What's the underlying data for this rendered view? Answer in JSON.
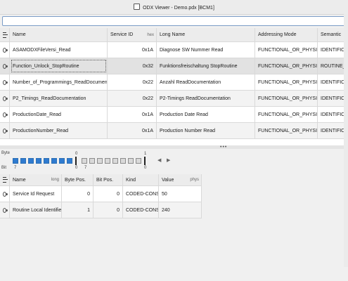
{
  "window": {
    "title": "ODX Viewer - Demo.pdx [BCM1]"
  },
  "search": {
    "value": ""
  },
  "main_table": {
    "headers": {
      "name": "Name",
      "service_id": "Service ID",
      "service_id_tag": "hex",
      "long_name": "Long Name",
      "addressing": "Addressing Mode",
      "semantic": "Semantic"
    },
    "rows": [
      {
        "name": "ASAMODXFileVersi_Read",
        "sid": "0x1A",
        "long_name": "Diagnose SW Nummer Read",
        "addressing": "FUNCTIONAL_OR_PHYSICAL",
        "semantic": "IDENTIFICATI"
      },
      {
        "name": "Function_Unlock_StopRoutine",
        "sid": "0x32",
        "long_name": "Funktionsfreischaltung StopRoutine",
        "addressing": "FUNCTIONAL_OR_PHYSICAL",
        "semantic": "ROUTINE_STO"
      },
      {
        "name": "Number_of_Programmings_ReadDocument...",
        "sid": "0x22",
        "long_name": "Anzahl ReadDocumentation",
        "addressing": "FUNCTIONAL_OR_PHYSICAL",
        "semantic": "IDENTIFICATI"
      },
      {
        "name": "P2_Timings_ReadDocumentation",
        "sid": "0x22",
        "long_name": "P2-Timings ReadDocumentation",
        "addressing": "FUNCTIONAL_OR_PHYSICAL",
        "semantic": "IDENTIFICATI"
      },
      {
        "name": "ProductionDate_Read",
        "sid": "0x1A",
        "long_name": "Production Date Read",
        "addressing": "FUNCTIONAL_OR_PHYSICAL",
        "semantic": "IDENTIFICATI"
      },
      {
        "name": "ProductionNumber_Read",
        "sid": "0x1A",
        "long_name": "Production Number Read",
        "addressing": "FUNCTIONAL_OR_PHYSICAL",
        "semantic": "IDENTIFICATI"
      }
    ]
  },
  "bit_view": {
    "byte_label": "Byte",
    "bit_label": "Bit",
    "byte_numbers": [
      "0",
      "1"
    ],
    "bit_numbers": [
      "7",
      "0",
      "7",
      "0"
    ],
    "byte0_filled": 8,
    "byte1_filled": 0,
    "prev_arrow": "◀",
    "next_arrow": "▶"
  },
  "param_table": {
    "headers": {
      "name": "Name",
      "name_tag": "long",
      "byte_pos": "Byte Pos.",
      "bit_pos": "Bit Pos.",
      "kind": "Kind",
      "value": "Value",
      "value_tag": "phys"
    },
    "rows": [
      {
        "name": "Service Id Request",
        "byte_pos": "0",
        "bit_pos": "0",
        "kind": "CODED-CONST",
        "value": "50"
      },
      {
        "name": "Routine Local Identifier",
        "byte_pos": "1",
        "bit_pos": "0",
        "kind": "CODED-CONST",
        "value": "240"
      }
    ]
  },
  "icons": {
    "row_icon": "eye-icon",
    "column_menu": "menu-icon",
    "splitter": "splitter-handle-icon"
  }
}
